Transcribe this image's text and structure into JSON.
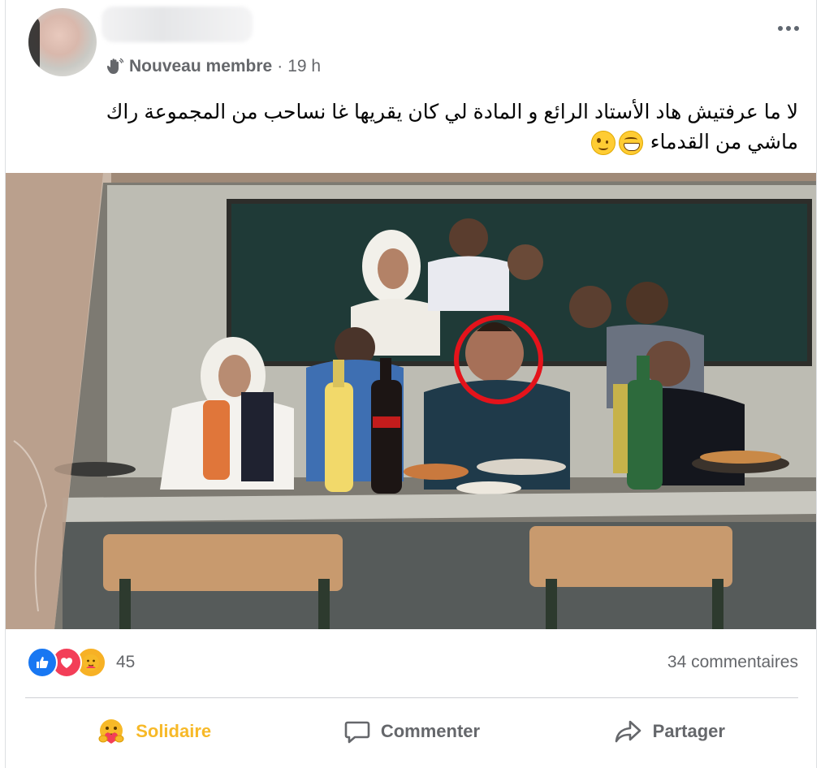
{
  "post": {
    "badge": "Nouveau membre",
    "separator": "·",
    "time": "19 h",
    "text_line1": "لا ما عرفتيش هاد الأستاد الرائع و المادة لي كان يقريها غا نساحب من المجموعة راك",
    "text_line2": "ماشي من القدماء"
  },
  "stats": {
    "reactions_count": "45",
    "comments": "34 commentaires"
  },
  "actions": {
    "react_label": "Solidaire",
    "comment_label": "Commenter",
    "share_label": "Partager"
  },
  "icons": {
    "more": "more-horizontal-icon",
    "badge": "wave-hand-icon",
    "like": "like-icon",
    "love": "love-icon",
    "care": "care-icon",
    "comment": "comment-icon",
    "share": "share-icon"
  },
  "colors": {
    "care_accent": "#f7b928",
    "like": "#1877f2",
    "love": "#f33e58",
    "highlight_circle": "#e4131b"
  }
}
